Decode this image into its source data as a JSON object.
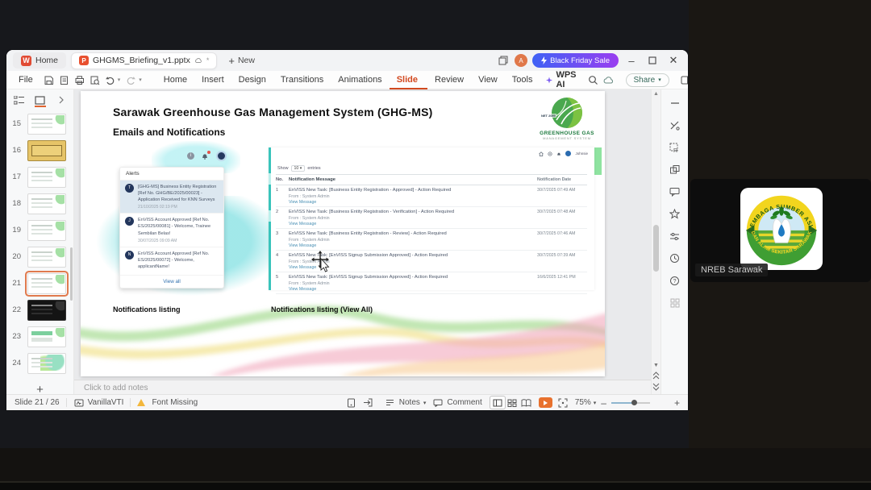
{
  "meeting": {
    "participant_name": "NREB Sarawak",
    "logo": {
      "arc_top": "LEMBAGA SUMBER ASLI",
      "arc_bottom": "DAN ALAM SEKITAR SARAWAK"
    }
  },
  "window": {
    "tabs": {
      "home": "Home",
      "document": "GHGMS_Briefing_v1.pptx",
      "new": "New"
    },
    "promo": {
      "label": "Black Friday Sale"
    },
    "menu": {
      "file": "File",
      "items": [
        {
          "label": "Home"
        },
        {
          "label": "Insert"
        },
        {
          "label": "Design"
        },
        {
          "label": "Transitions"
        },
        {
          "label": "Animations"
        },
        {
          "label": "Slide Show",
          "variant": "active"
        },
        {
          "label": "Review"
        },
        {
          "label": "View"
        },
        {
          "label": "Tools"
        }
      ],
      "wps_ai": "WPS AI",
      "share": "Share"
    }
  },
  "slides_panel": {
    "items": [
      {
        "num": "15",
        "variant": "v15"
      },
      {
        "num": "16",
        "variant": "v16"
      },
      {
        "num": "17",
        "variant": "v17"
      },
      {
        "num": "18",
        "variant": "v18"
      },
      {
        "num": "19",
        "variant": "v19"
      },
      {
        "num": "20",
        "variant": "v20"
      },
      {
        "num": "21",
        "variant": "v21"
      },
      {
        "num": "22",
        "variant": "v22"
      },
      {
        "num": "23",
        "variant": "v23"
      },
      {
        "num": "24",
        "variant": "v24"
      }
    ]
  },
  "slide": {
    "title": "Sarawak Greenhouse Gas Management System (GHG-MS)",
    "subtitle": "Emails and Notifications",
    "logo": {
      "badge": "NET 2050",
      "line1": "GREENHOUSE GAS",
      "line2": "MANAGEMENT SYSTEM"
    },
    "alerts": {
      "header": "Alerts",
      "view_all": "View all",
      "items": [
        {
          "initial": "T",
          "variant": "highlight",
          "text": "[GHG-MS] Business Entity Registration [Ref No. GHG/BE/2025/00023] - Application Received for KNN Surveys",
          "time": "21/10/2025 02:19 PM"
        },
        {
          "initial": "J",
          "text": "EnVISS Account Approved [Ref No. ES/2025/00081] - Welcome, Trainee Sembilan Belas!",
          "time": "30/07/2025 09:09 AM"
        },
        {
          "initial": "N",
          "text": "EnVISS Account Approved [Ref No. ES/2025/00072] - Welcome, applicantName!"
        }
      ]
    },
    "notifications": {
      "user": "Johnsie",
      "show": "Show",
      "page_size": "10",
      "entries": "entries",
      "headers": {
        "no": "No.",
        "message": "Notification Message",
        "date": "Notification Date"
      },
      "rows": [
        {
          "no": "1",
          "message": "EnVISS New Task: [Business Entity Registration - Approved] - Action Required",
          "from": "From : System Admin",
          "link": "View Message",
          "date": "30/7/2025 07:49 AM"
        },
        {
          "no": "2",
          "message": "EnVISS New Task: [Business Entity Registration - Verification] - Action Required",
          "from": "From : System Admin",
          "link": "View Message",
          "date": "30/7/2025 07:48 AM"
        },
        {
          "no": "3",
          "message": "EnVISS New Task: [Business Entity Registration - Review] - Action Required",
          "from": "From : System Admin",
          "link": "View Message",
          "date": "30/7/2025 07:46 AM"
        },
        {
          "no": "4",
          "message": "EnVISS New Task: [EnVISS Signup Submission Approved] - Action Required",
          "from": "From : System Admin",
          "link": "View Message",
          "date": "30/7/2025 07:39 AM"
        },
        {
          "no": "5",
          "message": "EnVISS New Task: [EnVISS Signup Submission Approved] - Action Required",
          "from": "From : System Admin",
          "link": "View Message",
          "date": "16/6/2025 12:41 PM"
        }
      ]
    },
    "captions": {
      "left": "Notifications listing",
      "right": "Notifications listing (View All)"
    }
  },
  "notes": {
    "placeholder": "Click to add notes"
  },
  "statusbar": {
    "slide_indicator": "Slide 21 / 26",
    "theme": "VanillaVTI",
    "font_missing": "Font Missing",
    "notes": "Notes",
    "comment": "Comment",
    "zoom": "75%"
  },
  "colors": {
    "accent": "#d2491f",
    "promo_start": "#3f62f5",
    "promo_end": "#9a3ef0",
    "play": "#e8712e",
    "teal": "#39c4bb"
  }
}
